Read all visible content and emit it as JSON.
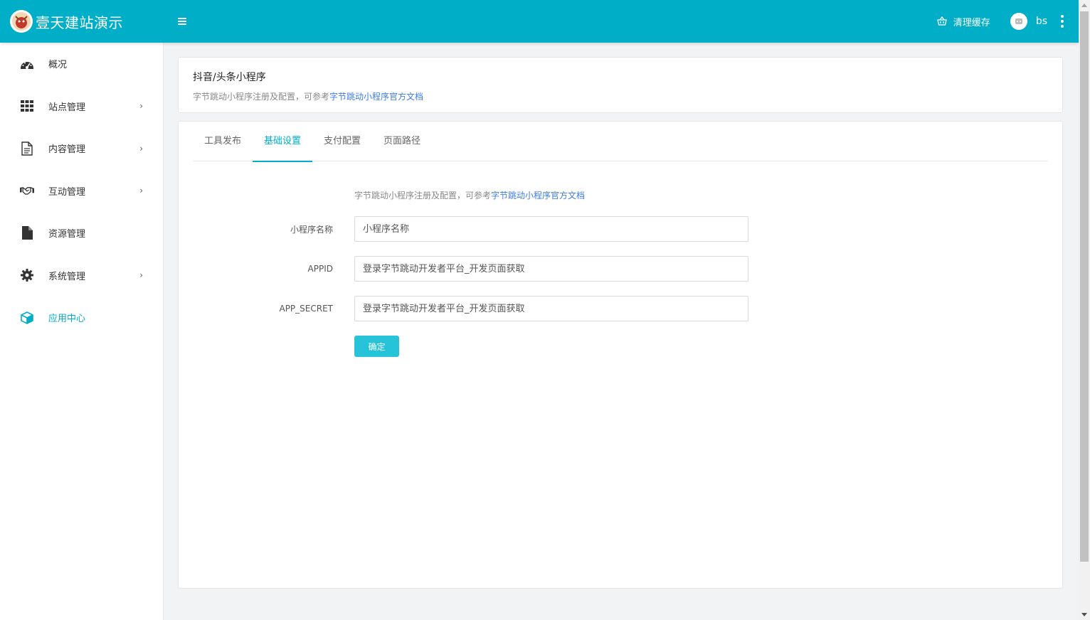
{
  "app": {
    "brand": "壹天建站演示"
  },
  "header": {
    "clear_cache": "清理缓存",
    "username": "bs"
  },
  "sidebar": {
    "items": [
      {
        "label": "概况",
        "icon": "dashboard-icon",
        "has_arrow": false
      },
      {
        "label": "站点管理",
        "icon": "grid-icon",
        "has_arrow": true
      },
      {
        "label": "内容管理",
        "icon": "document-icon",
        "has_arrow": true
      },
      {
        "label": "互动管理",
        "icon": "handshake-icon",
        "has_arrow": true
      },
      {
        "label": "资源管理",
        "icon": "file-icon",
        "has_arrow": false
      },
      {
        "label": "系统管理",
        "icon": "gear-icon",
        "has_arrow": true
      },
      {
        "label": "应用中心",
        "icon": "cube-icon",
        "has_arrow": false,
        "active": true
      }
    ]
  },
  "page": {
    "title": "抖音/头条小程序",
    "desc_prefix": "字节跳动小程序注册及配置，可参考",
    "desc_link": "字节跳动小程序官方文档"
  },
  "tabs": [
    {
      "label": "工具发布"
    },
    {
      "label": "基础设置",
      "active": true
    },
    {
      "label": "支付配置"
    },
    {
      "label": "页面路径"
    }
  ],
  "form": {
    "hint_prefix": "字节跳动小程序注册及配置，可参考",
    "hint_link": "字节跳动小程序官方文档",
    "name_label": "小程序名称",
    "name_placeholder": "小程序名称",
    "appid_label": "APPID",
    "appid_placeholder": "登录字节跳动开发者平台_开发页面获取",
    "secret_label": "APP_SECRET",
    "secret_placeholder": "登录字节跳动开发者平台_开发页面获取",
    "submit_label": "确定"
  },
  "colors": {
    "primary": "#00aec7",
    "button": "#27c3d8",
    "link": "#3f7ce0"
  }
}
